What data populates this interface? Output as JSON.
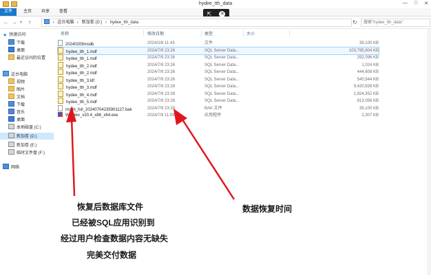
{
  "window": {
    "title": "hydee_tth_data",
    "minimize": "—",
    "maximize": "□",
    "close": "✕"
  },
  "ribbon": {
    "tabs": [
      "文件",
      "主页",
      "共享",
      "查看"
    ]
  },
  "overlay": {
    "pointer_glyph": "⇱",
    "close_glyph": "✕"
  },
  "address": {
    "back": "←",
    "forward": "→",
    "up": "↑",
    "path": [
      "这台电脑",
      "新加卷 (D:)",
      "hydee_tth_data"
    ],
    "separator": "›",
    "refresh": "↻",
    "search_placeholder": "搜索\"hydee_tth_data\""
  },
  "sidebar": {
    "items": [
      {
        "label": "快速访问",
        "icon": "star-icon"
      },
      {
        "label": "下载",
        "icon": "download-folder-icon"
      },
      {
        "label": "桌面",
        "icon": "desktop-icon"
      },
      {
        "label": "最近访问的位置",
        "icon": "recent-icon"
      },
      {
        "label": "这台电脑",
        "icon": "computer-icon"
      },
      {
        "label": "视频",
        "icon": "video-folder-icon"
      },
      {
        "label": "图片",
        "icon": "picture-folder-icon"
      },
      {
        "label": "文档",
        "icon": "document-folder-icon"
      },
      {
        "label": "下载",
        "icon": "download-folder-icon"
      },
      {
        "label": "音乐",
        "icon": "music-folder-icon"
      },
      {
        "label": "桌面",
        "icon": "desktop-icon"
      },
      {
        "label": "本地磁盘 (C:)",
        "icon": "drive-icon"
      },
      {
        "label": "新加卷 (D:)",
        "icon": "drive-icon"
      },
      {
        "label": "新加卷 (E:)",
        "icon": "drive-icon"
      },
      {
        "label": "临时文件盘 (F:)",
        "icon": "drive-icon"
      },
      {
        "label": "网络",
        "icon": "network-icon"
      }
    ]
  },
  "columns": {
    "name": "名称",
    "date": "修改日期",
    "type": "类型",
    "size": "大小"
  },
  "files": [
    {
      "name": "20240208msdb",
      "date": "2024/2/8 11:43",
      "type": "文件",
      "size": "39,100 KB",
      "icon": "file-icon"
    },
    {
      "name": "hydee_tth_1.mdf",
      "date": "2024/7/9 23:26",
      "type": "SQL Server Data...",
      "size": "103,795,904 KB",
      "icon": "mdf-file-icon"
    },
    {
      "name": "hydee_tth_1.mdf",
      "date": "2024/7/9 23:26",
      "type": "SQL Server Data...",
      "size": "292,096 KB",
      "icon": "mdf-file-icon"
    },
    {
      "name": "hydee_tth_2.mdf",
      "date": "2024/7/9 23:26",
      "type": "SQL Server Data...",
      "size": "1,024 KB",
      "icon": "mdf-file-icon"
    },
    {
      "name": "hydee_tth_2.mdf",
      "date": "2024/7/9 23:26",
      "type": "SQL Server Data...",
      "size": "444,608 KB",
      "icon": "mdf-file-icon"
    },
    {
      "name": "hydee_tth_3.ldf",
      "date": "2024/7/9 23:26",
      "type": "SQL Server Data...",
      "size": "540,544 KB",
      "icon": "mdf-file-icon"
    },
    {
      "name": "hydee_tth_3.mdf",
      "date": "2024/7/9 23:28",
      "type": "SQL Server Data...",
      "size": "9,420,928 KB",
      "icon": "mdf-file-icon"
    },
    {
      "name": "hydee_tth_4.mdf",
      "date": "2024/7/9 23:28",
      "type": "SQL Server Data...",
      "size": "1,924,352 KB",
      "icon": "mdf-file-icon"
    },
    {
      "name": "hydee_tth_5.mdf",
      "date": "2024/7/9 23:26",
      "type": "SQL Server Data...",
      "size": "813,056 KB",
      "icon": "mdf-file-icon"
    },
    {
      "name": "msdb_full_20240704235901127.bak",
      "date": "2024/7/9 23:28",
      "type": "BAK 文件",
      "size": "39,100 KB",
      "icon": "bak-file-icon"
    },
    {
      "name": "WinHex_v20.4_x86_x64.exe",
      "date": "2024/7/9 11:09",
      "type": "应用程序",
      "size": "2,307 KB",
      "icon": "exe-app-icon"
    }
  ],
  "annotations": {
    "left": [
      "恢复后数据库文件",
      "已经被SQL应用识别到",
      "经过用户检查数据内容无缺失",
      "完美交付数据"
    ],
    "right": "数据恢复时间"
  },
  "colors": {
    "arrow": "#e0161c",
    "accent": "#1979ca",
    "selection": "#cde8ff"
  }
}
